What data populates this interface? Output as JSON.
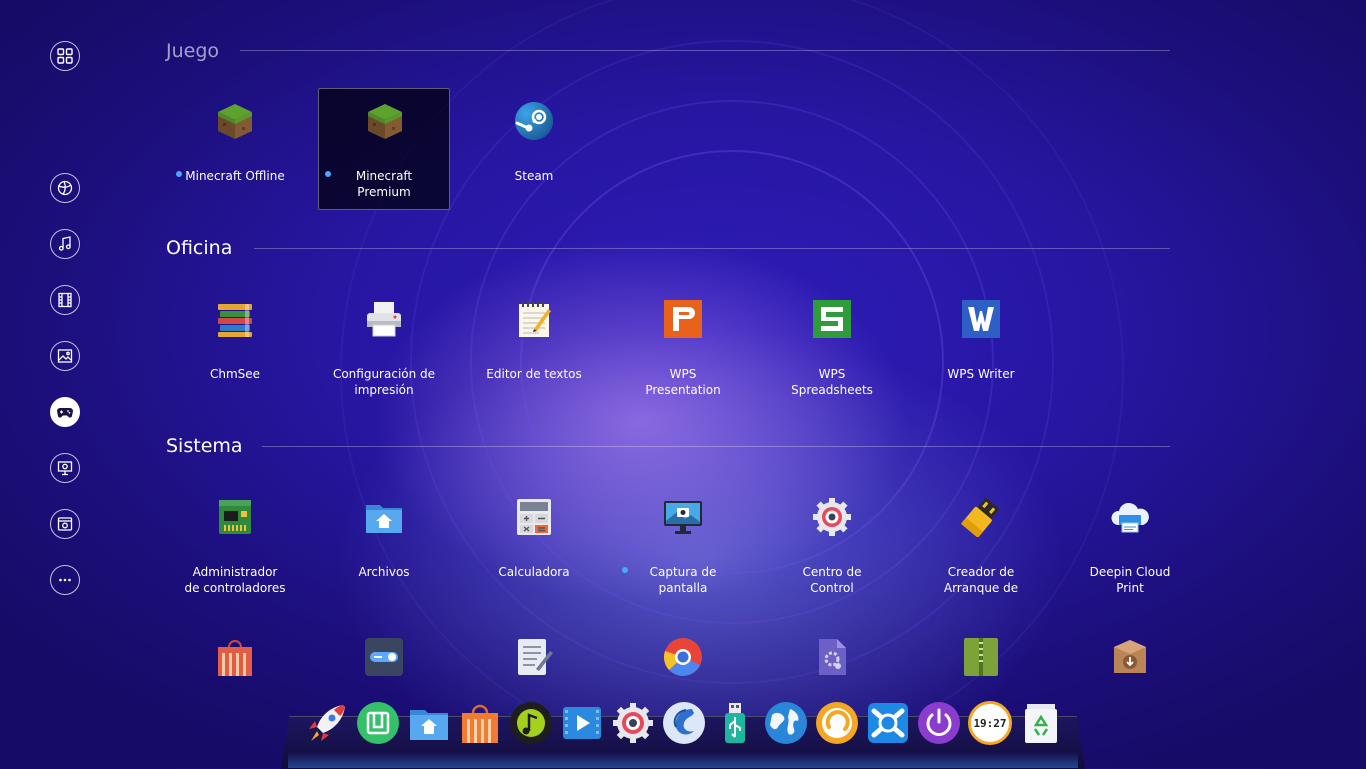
{
  "sections": [
    {
      "title": "Juego",
      "apps": [
        {
          "label": "Minecraft Offline",
          "icon": "minecraft-icon",
          "new": true
        },
        {
          "label": "Minecraft\nPremium",
          "icon": "minecraft-icon",
          "new": true,
          "selected": true
        },
        {
          "label": "Steam",
          "icon": "steam-icon"
        }
      ]
    },
    {
      "title": "Oficina",
      "apps": [
        {
          "label": "ChmSee",
          "icon": "books-icon"
        },
        {
          "label": "Configuración de\nimpresión",
          "icon": "printer-icon"
        },
        {
          "label": "Editor de textos",
          "icon": "notepad-icon"
        },
        {
          "label": "WPS\nPresentation",
          "icon": "wps-presentation-icon"
        },
        {
          "label": "WPS\nSpreadsheets",
          "icon": "wps-spreadsheets-icon"
        },
        {
          "label": "WPS Writer",
          "icon": "wps-writer-icon"
        }
      ]
    },
    {
      "title": "Sistema",
      "apps": [
        {
          "label": "Administrador\nde controladores",
          "icon": "driver-board-icon"
        },
        {
          "label": "Archivos",
          "icon": "folder-home-icon"
        },
        {
          "label": "Calculadora",
          "icon": "calculator-icon"
        },
        {
          "label": "Captura de\npantalla",
          "icon": "screenshot-icon",
          "new": true
        },
        {
          "label": "Centro de\nControl",
          "icon": "control-center-icon"
        },
        {
          "label": "Creador de\nArranque de",
          "icon": "usb-boot-icon"
        },
        {
          "label": "Deepin Cloud\nPrint",
          "icon": "cloud-print-icon"
        }
      ]
    }
  ],
  "sistema_row2": [
    "store-bag-icon",
    "toggle-switch-icon",
    "task-list-icon",
    "chromium-icon",
    "gear-file-icon",
    "archive-icon",
    "package-icon"
  ],
  "sidebar": [
    "all-apps-icon",
    "internet-icon",
    "music-icon",
    "video-icon",
    "image-icon",
    "game-icon",
    "office-icon",
    "system-icon",
    "more-icon"
  ],
  "sidebar_active": "game-icon",
  "dock": [
    "launcher-rocket-icon",
    "multitask-view-icon",
    "file-manager-icon",
    "app-store-icon",
    "music-player-icon",
    "movie-player-icon",
    "control-center-icon",
    "browser-icon",
    "usb-installer-icon",
    "globe-icon",
    "clock-icon",
    "deepin-icon",
    "power-icon",
    "datetime-icon",
    "trash-icon"
  ],
  "clock_text": "19:27",
  "colors": {
    "accent_dot": "#48a8ff",
    "bg_dark": "#1c0f7c"
  }
}
